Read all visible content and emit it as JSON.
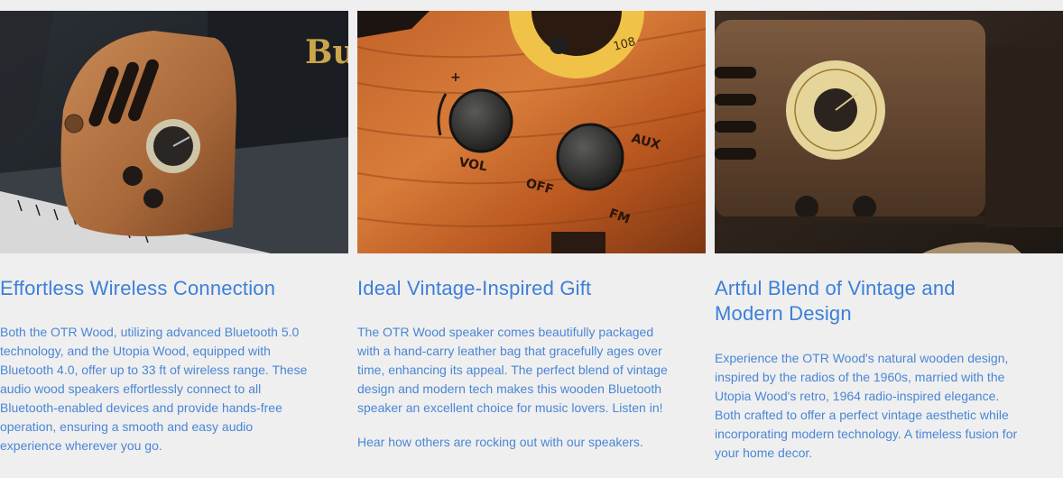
{
  "cards": [
    {
      "image_alt": "OTR Wood speaker on vintage equipment",
      "title": "Effortless Wireless Connection",
      "body": "Both the OTR Wood, utilizing advanced Bluetooth 5.0 technology, and the Utopia Wood, equipped with Bluetooth 4.0, offer up to 33 ft of wireless range. These audio wood speakers effortlessly connect to all Bluetooth-enabled devices and provide hands-free operation, ensuring a smooth and easy audio experience wherever you go.",
      "logo_text": "Bu"
    },
    {
      "image_alt": "Close-up of OTR Wood speaker knobs",
      "title": "Ideal Vintage-Inspired Gift",
      "body": "The OTR Wood speaker comes beautifully packaged with a hand-carry leather bag that gracefully ages over time, enhancing its appeal. The perfect blend of vintage design and modern tech makes this wooden Bluetooth speaker an excellent choice for music lovers. Listen in!",
      "body2": "Hear how others are rocking out with our speakers.",
      "knob_labels": [
        "+",
        "VOL",
        "OFF",
        "AUX",
        "FM",
        "108"
      ]
    },
    {
      "image_alt": "Utopia Wood radio-inspired speaker",
      "title": "Artful Blend of Vintage and Modern Design",
      "body": "Experience the OTR Wood's natural wooden design, inspired by the radios of the 1960s, married with the Utopia Wood's retro, 1964 radio-inspired elegance. Both crafted to offer a perfect vintage aesthetic while incorporating modern technology. A timeless fusion for your home decor."
    }
  ],
  "colors": {
    "accent": "#3d7fd8",
    "background": "#efefef"
  }
}
